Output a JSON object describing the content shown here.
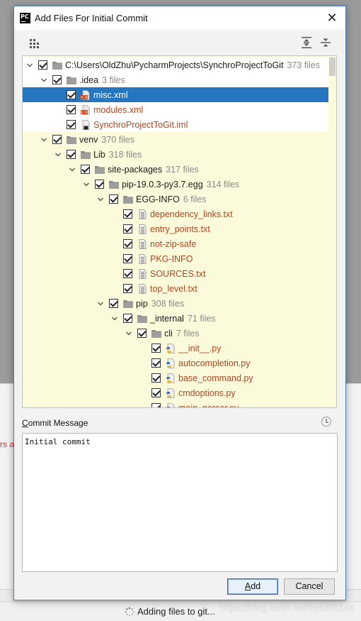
{
  "dialog": {
    "title": "Add Files For Initial Commit",
    "app_icon": "PC",
    "close_glyph": "✕"
  },
  "toolbar": {
    "group_icon": "group-by-icon",
    "expand_icon": "expand-all-icon",
    "collapse_icon": "collapse-all-icon"
  },
  "tree": {
    "rows": [
      {
        "name": "C:\\Users\\OldZhu\\PycharmProjects\\SynchroProjectToGit",
        "count": "373 files",
        "type": "dir",
        "depth": 0,
        "expanded": true
      },
      {
        "name": ".idea",
        "count": "3 files",
        "type": "dir",
        "depth": 1,
        "expanded": true
      },
      {
        "name": "misc.xml",
        "count": "",
        "type": "xml",
        "depth": 2,
        "selected": true
      },
      {
        "name": "modules.xml",
        "count": "",
        "type": "xml",
        "depth": 2
      },
      {
        "name": "SynchroProjectToGit.iml",
        "count": "",
        "type": "iml",
        "depth": 2
      },
      {
        "name": "venv",
        "count": "370 files",
        "type": "dir",
        "depth": 1,
        "expanded": true
      },
      {
        "name": "Lib",
        "count": "318 files",
        "type": "dir",
        "depth": 2,
        "expanded": true
      },
      {
        "name": "site-packages",
        "count": "317 files",
        "type": "dir",
        "depth": 3,
        "expanded": true
      },
      {
        "name": "pip-19.0.3-py3.7.egg",
        "count": "314 files",
        "type": "dir",
        "depth": 4,
        "expanded": true
      },
      {
        "name": "EGG-INFO",
        "count": "6 files",
        "type": "dir",
        "depth": 5,
        "expanded": true
      },
      {
        "name": "dependency_links.txt",
        "count": "",
        "type": "txt",
        "depth": 6
      },
      {
        "name": "entry_points.txt",
        "count": "",
        "type": "txt",
        "depth": 6
      },
      {
        "name": "not-zip-safe",
        "count": "",
        "type": "txt",
        "depth": 6
      },
      {
        "name": "PKG-INFO",
        "count": "",
        "type": "txt",
        "depth": 6
      },
      {
        "name": "SOURCES.txt",
        "count": "",
        "type": "txt",
        "depth": 6
      },
      {
        "name": "top_level.txt",
        "count": "",
        "type": "txt",
        "depth": 6
      },
      {
        "name": "pip",
        "count": "308 files",
        "type": "dir",
        "depth": 5,
        "expanded": true
      },
      {
        "name": "_internal",
        "count": "71 files",
        "type": "dir",
        "depth": 6,
        "expanded": true
      },
      {
        "name": "cli",
        "count": "7 files",
        "type": "dir",
        "depth": 7,
        "expanded": true
      },
      {
        "name": "__init__.py",
        "count": "",
        "type": "py",
        "depth": 8
      },
      {
        "name": "autocompletion.py",
        "count": "",
        "type": "py",
        "depth": 8
      },
      {
        "name": "base_command.py",
        "count": "",
        "type": "py",
        "depth": 8
      },
      {
        "name": "cmdoptions.py",
        "count": "",
        "type": "py",
        "depth": 8
      },
      {
        "name": "main_parser.py",
        "count": "",
        "type": "py",
        "depth": 8
      }
    ]
  },
  "commit": {
    "label_prefix": "C",
    "label_rest": "ommit Message",
    "message": "Initial commit",
    "history_icon": "clock-icon"
  },
  "buttons": {
    "add_prefix": "A",
    "add_rest": "dd",
    "cancel": "Cancel"
  },
  "background": {
    "error_fragment": "rs a",
    "status": "Adding files to git...",
    "watermark": "https://blog.csdn.net/zys351148"
  },
  "colors": {
    "selection": "#2675bf",
    "tree_bg": "#fbfbdc",
    "file_text": "#b4431f",
    "default_button_border": "#2f6fc0"
  }
}
